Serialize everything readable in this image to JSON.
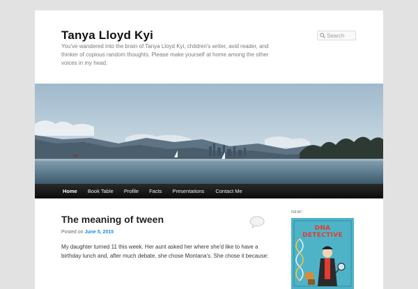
{
  "site": {
    "title": "Tanya Lloyd Kyi",
    "description": "You've wandered into the brain of Tanya Lloyd Kyi, children's writer, avid reader, and thinker of copious random thoughts. Please make yourself at home among the other voices in my head."
  },
  "search": {
    "placeholder": "Search",
    "icon": "search-icon"
  },
  "nav": {
    "items": [
      {
        "label": "Home",
        "current": true
      },
      {
        "label": "Book Table",
        "current": false
      },
      {
        "label": "Profile",
        "current": false
      },
      {
        "label": "Facts",
        "current": false
      },
      {
        "label": "Presentations",
        "current": false
      },
      {
        "label": "Contact Me",
        "current": false
      }
    ]
  },
  "post": {
    "title": "The meaning of tween",
    "posted_prefix": "Posted on",
    "date": "June 5, 2015",
    "body": "My daughter turned 11 this week. Her aunt asked her where she'd like to have a birthday lunch and, after much debate, she chose Montana's. She chose it because:",
    "comment_icon": "comment-bubble-icon"
  },
  "sidebar": {
    "new_label": "NEW!",
    "book_title": "DNA DETECTIVE"
  },
  "colors": {
    "link": "#1b8be0",
    "nav_bg": "#111111",
    "page_bg": "#e2e2e2"
  }
}
